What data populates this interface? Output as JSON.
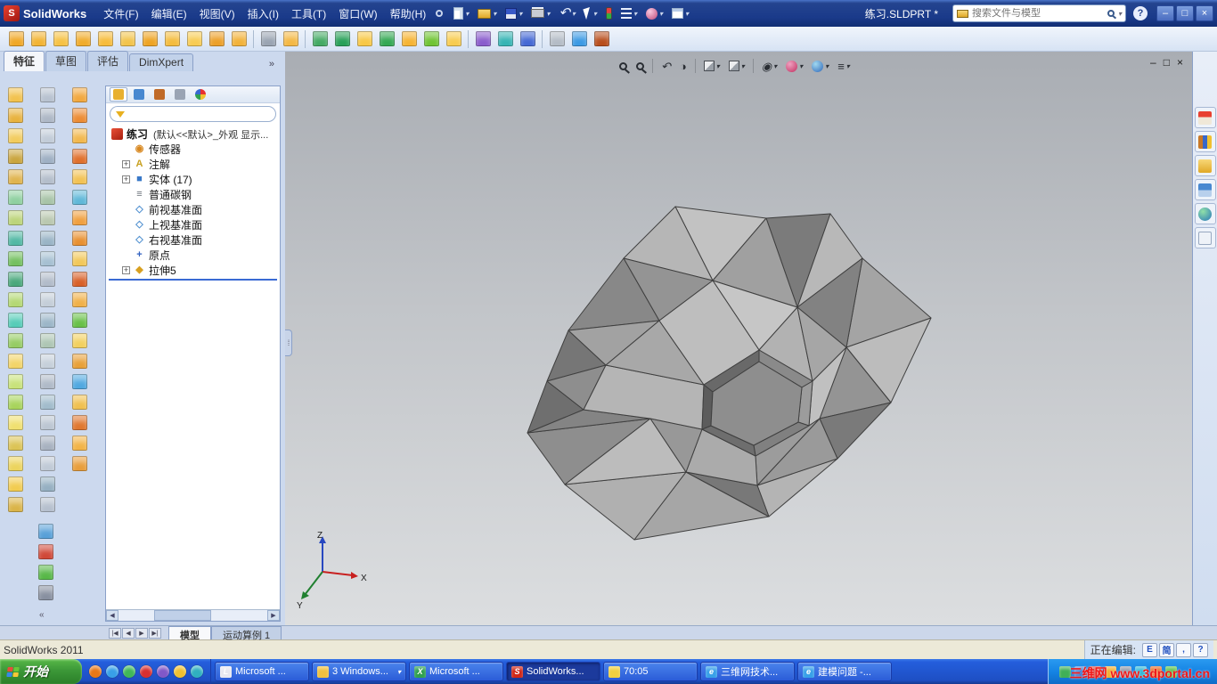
{
  "titlebar": {
    "logo_letter": "S",
    "logo_text": "SolidWorks",
    "menus": [
      "文件(F)",
      "编辑(E)",
      "视图(V)",
      "插入(I)",
      "工具(T)",
      "窗口(W)",
      "帮助(H)"
    ],
    "document_title": "练习.SLDPRT *",
    "search_placeholder": "搜索文件与模型",
    "help_label": "?",
    "window_buttons": [
      "–",
      "□",
      "×"
    ]
  },
  "toolbar2_colors": [
    "#f0a828",
    "#f2b434",
    "#f6c244",
    "#f0ac2c",
    "#f6bc3c",
    "#f2c44c",
    "#eea424",
    "#f4bc3e",
    "#f8cc54",
    "#eca02a",
    "#f2b23a",
    "#9aa4b2",
    "#f4b844",
    "#44aa64",
    "#28a058",
    "#f8c846",
    "#34a854",
    "#f6b434",
    "#70c434",
    "#f8cc50",
    "#8a5ccc",
    "#36b4b4",
    "#4468d4",
    "#b4bcc6",
    "#3c9ae4",
    "#b84e1c"
  ],
  "toolbar2_separators": [
    11,
    13,
    20,
    23
  ],
  "command_tabs": {
    "items": [
      "特征",
      "草图",
      "评估",
      "DimXpert"
    ],
    "active_index": 0,
    "overflow": "»"
  },
  "left_toolbar": {
    "col1": [
      "#f2c24e",
      "#e8b23e",
      "#f2cc5e",
      "#caa53e",
      "#e0b44e",
      "#8fd0a0",
      "#bcd47a",
      "#52b8a4",
      "#74c060",
      "#4aa87c",
      "#b4d874",
      "#56ccb8",
      "#96cc64",
      "#f2d468",
      "#c8e27a",
      "#a8d45c",
      "#f0e070",
      "#dcc456",
      "#ecd45e",
      "#f2cc50",
      "#dab448"
    ],
    "col2": [
      "#b8c2d0",
      "#aeb8c6",
      "#c2ccd8",
      "#9fb0c4",
      "#b4becb",
      "#a8c4a8",
      "#bac8b0",
      "#9ab4c6",
      "#a6c0d2",
      "#b2bcca",
      "#c4ced8",
      "#9cb6c8",
      "#aec6b4",
      "#c6d0da",
      "#b0bac8",
      "#a2bccc",
      "#bcc6d2",
      "#a8b2c0",
      "#c0cad6",
      "#96b0c2",
      "#b6c0ce"
    ],
    "col3": [
      "#f2a83e",
      "#ec8c34",
      "#f2b84e",
      "#e0702c",
      "#f2c254",
      "#60b8d8",
      "#f0a040",
      "#e89030",
      "#f2c85a",
      "#d86028",
      "#f0b048",
      "#68c048",
      "#f2d05e",
      "#e8a038",
      "#50a8e0",
      "#f0c050",
      "#e07830",
      "#f2b448",
      "#e89e3c"
    ],
    "bottom": [
      "#58a0d8",
      "#d04838",
      "#58b848",
      "#8890a0"
    ],
    "collapse_chevron": "«"
  },
  "panel": {
    "manager_tabs": [
      "feature-manager-tab",
      "property-manager-tab",
      "configuration-manager-tab",
      "dimxpert-manager-tab",
      "display-manager-tab"
    ],
    "manager_colors": [
      "#e8b030",
      "#4888d0",
      "#c06a28",
      "#9aa4b4",
      "#d04898"
    ],
    "filter_placeholder": ""
  },
  "feature_tree": {
    "root_label": "练习",
    "root_suffix": "(默认<<默认>_外观 显示...",
    "items": [
      {
        "label": "传感器",
        "icon": "sensors-icon",
        "expand": false,
        "glyph": "◉",
        "color": "#d88820"
      },
      {
        "label": "注解",
        "icon": "annotations-icon",
        "expand": true,
        "glyph": "A",
        "color": "#c8a020"
      },
      {
        "label": "实体 (17)",
        "icon": "solid-bodies-icon",
        "expand": true,
        "glyph": "■",
        "color": "#3878c8"
      },
      {
        "label": "普通碳钢",
        "icon": "material-icon",
        "expand": false,
        "glyph": "≡",
        "color": "#687078"
      },
      {
        "label": "前视基准面",
        "icon": "plane-icon",
        "expand": false,
        "glyph": "◇",
        "color": "#5090d0"
      },
      {
        "label": "上视基准面",
        "icon": "plane-icon",
        "expand": false,
        "glyph": "◇",
        "color": "#5090d0"
      },
      {
        "label": "右视基准面",
        "icon": "plane-icon",
        "expand": false,
        "glyph": "◇",
        "color": "#5090d0"
      },
      {
        "label": "原点",
        "icon": "origin-icon",
        "expand": false,
        "glyph": "+",
        "color": "#3060c0"
      },
      {
        "label": "拉伸5",
        "icon": "extrude-feature-icon",
        "expand": true,
        "glyph": "◆",
        "color": "#d8a020"
      }
    ]
  },
  "hud": {
    "icons": [
      {
        "name": "zoom-fit-icon",
        "cls": "mag"
      },
      {
        "name": "zoom-area-icon",
        "cls": "mag"
      },
      {
        "name": "previous-view-icon",
        "cls": "glyph",
        "glyph": "↶",
        "sep_before": true
      },
      {
        "name": "section-view-icon",
        "cls": "glyph",
        "glyph": "◑"
      },
      {
        "name": "view-orientation-icon",
        "cls": "cube",
        "caret": true,
        "sep_before": true
      },
      {
        "name": "display-style-icon",
        "cls": "cube",
        "caret": true
      },
      {
        "name": "hide-show-items-icon",
        "cls": "glyph",
        "glyph": "◉",
        "caret": true,
        "sep_before": true
      },
      {
        "name": "edit-appearance-icon",
        "cls": "ball",
        "caret": true
      },
      {
        "name": "apply-scene-icon",
        "cls": "ball2",
        "caret": true
      },
      {
        "name": "view-settings-icon",
        "cls": "glyph",
        "glyph": "≡",
        "caret": true
      }
    ]
  },
  "viewport": {
    "window_controls": [
      "–",
      "□",
      "×"
    ],
    "triad": {
      "x": "X",
      "y": "Y",
      "z": "Z"
    }
  },
  "taskpane_icons": [
    "home-icon",
    "design-library-icon",
    "file-explorer-icon",
    "view-palette-icon",
    "appearances-icon",
    "custom-properties-icon"
  ],
  "bottom_bar": {
    "nav": [
      "|◀",
      "◀",
      "▶",
      "▶|"
    ],
    "tabs": [
      "模型",
      "运动算例 1"
    ],
    "active_index": 0
  },
  "statusbar": {
    "left": "SolidWorks 2011",
    "editing": "正在编辑:",
    "lang": [
      "E",
      "简",
      ",",
      "?"
    ]
  },
  "taskbar": {
    "start_label": "开始",
    "flag_colors": [
      "#e84c3c",
      "#68c838",
      "#3888e8",
      "#f8c838"
    ],
    "quick_launch": [
      "#e87818",
      "#38a0e8",
      "#40b858",
      "#d83030",
      "#8058c8",
      "#f0c030",
      "#30b0c0"
    ],
    "tasks": [
      {
        "label": "Microsoft ...",
        "color": "#e8e8f0",
        "letter": "L",
        "active": false
      },
      {
        "label": "3 Windows...",
        "color": "#f0c040",
        "letter": "",
        "active": false,
        "dropdown": true
      },
      {
        "label": "Microsoft ...",
        "color": "#30a050",
        "letter": "X",
        "active": false
      },
      {
        "label": "SolidWorks...",
        "color": "#d02818",
        "letter": "S",
        "active": true
      },
      {
        "label": "70:05",
        "color": "#f0d040",
        "letter": "",
        "active": false
      },
      {
        "label": "三维网技术...",
        "color": "#38a0e8",
        "letter": "e",
        "active": false
      },
      {
        "label": "建模问题 -...",
        "color": "#38a0e8",
        "letter": "e",
        "active": false
      }
    ],
    "tray_icons": [
      "#40b058",
      "#3878d0",
      "#d04038",
      "#f0b030",
      "#9098a8",
      "#30b8d8",
      "#e86820",
      "#58c048"
    ],
    "watermark": "三维网 www.3dportal.cn"
  }
}
